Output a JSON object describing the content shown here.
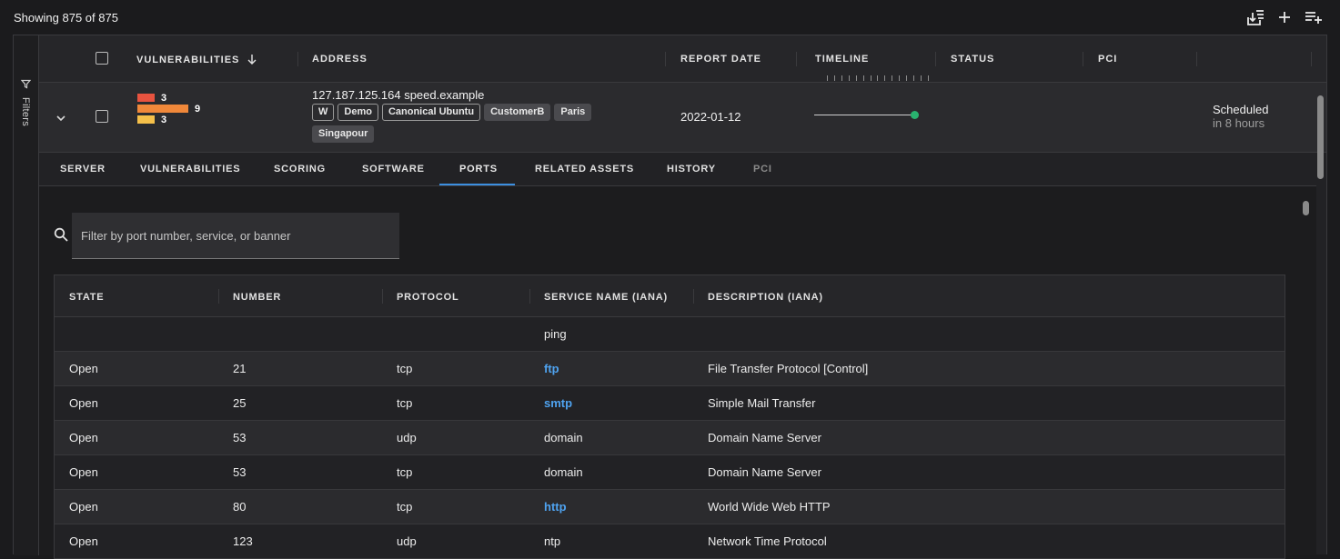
{
  "topbar": {
    "showing": "Showing 875 of 875",
    "actions": [
      {
        "name": "download-list-icon"
      },
      {
        "name": "plus-icon"
      },
      {
        "name": "add-list-icon"
      }
    ]
  },
  "filters": {
    "label": "Filters",
    "icon": "funnel-icon"
  },
  "table": {
    "columns": {
      "vulnerabilities": "Vulnerabilities",
      "address": "Address",
      "report_date": "Report Date",
      "timeline": "Timeline",
      "status": "Status",
      "pci": "PCI"
    },
    "sort_icon": "arrow-down-icon"
  },
  "asset": {
    "vulnerability_counts": [
      {
        "severity": "critical",
        "count": "3",
        "color": "#e8533f"
      },
      {
        "severity": "high",
        "count": "9",
        "color": "#f0883a"
      },
      {
        "severity": "medium",
        "count": "3",
        "color": "#f5c04a"
      }
    ],
    "address": "127.187.125.164 speed.example",
    "tags": [
      {
        "label": "W",
        "style": "outline"
      },
      {
        "label": "Demo",
        "style": "outline"
      },
      {
        "label": "Canonical Ubuntu",
        "style": "outline"
      },
      {
        "label": "CustomerB",
        "style": "filled"
      },
      {
        "label": "Paris",
        "style": "filled"
      },
      {
        "label": "Singapour",
        "style": "filled"
      }
    ],
    "report_date": "2022-01-12",
    "timeline_color": "#29b36f",
    "status_line1": "Scheduled",
    "status_line2": "in 8 hours"
  },
  "tabs": [
    {
      "label": "Server",
      "state": "normal"
    },
    {
      "label": "Vulnerabilities",
      "state": "normal"
    },
    {
      "label": "Scoring",
      "state": "normal"
    },
    {
      "label": "Software",
      "state": "normal"
    },
    {
      "label": "Ports",
      "state": "active"
    },
    {
      "label": "Related Assets",
      "state": "normal"
    },
    {
      "label": "History",
      "state": "normal"
    },
    {
      "label": "PCI",
      "state": "disabled"
    }
  ],
  "ports_search": {
    "placeholder": "Filter by port number, service, or banner"
  },
  "ports": {
    "columns": {
      "state": "State",
      "number": "Number",
      "protocol": "Protocol",
      "service": "Service Name (IANA)",
      "description": "Description (IANA)"
    },
    "rows": [
      {
        "state": "",
        "number": "",
        "protocol": "",
        "service": "ping",
        "service_link": false,
        "description": ""
      },
      {
        "state": "Open",
        "number": "21",
        "protocol": "tcp",
        "service": "ftp",
        "service_link": true,
        "description": "File Transfer Protocol [Control]"
      },
      {
        "state": "Open",
        "number": "25",
        "protocol": "tcp",
        "service": "smtp",
        "service_link": true,
        "description": "Simple Mail Transfer"
      },
      {
        "state": "Open",
        "number": "53",
        "protocol": "udp",
        "service": "domain",
        "service_link": false,
        "description": "Domain Name Server"
      },
      {
        "state": "Open",
        "number": "53",
        "protocol": "tcp",
        "service": "domain",
        "service_link": false,
        "description": "Domain Name Server"
      },
      {
        "state": "Open",
        "number": "80",
        "protocol": "tcp",
        "service": "http",
        "service_link": true,
        "description": "World Wide Web HTTP"
      },
      {
        "state": "Open",
        "number": "123",
        "protocol": "udp",
        "service": "ntp",
        "service_link": false,
        "description": "Network Time Protocol"
      }
    ]
  }
}
